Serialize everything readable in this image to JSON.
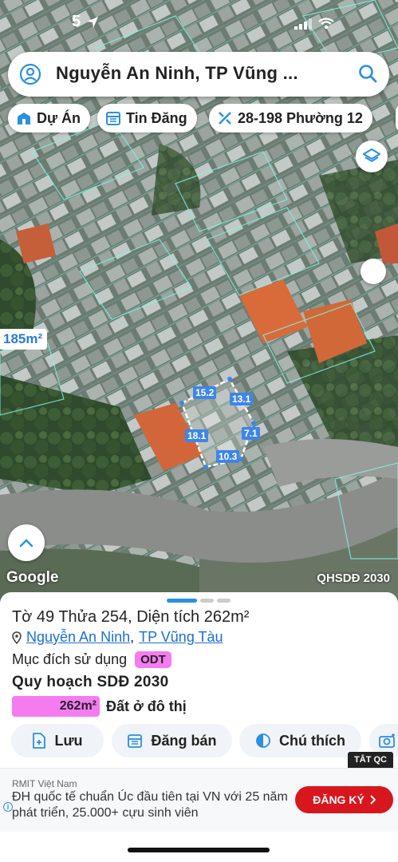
{
  "status_bar": {
    "time": "5"
  },
  "search": {
    "query": "Nguyễn An Ninh, TP Vũng ..."
  },
  "filters": [
    {
      "label": "Dự Án"
    },
    {
      "label": "Tin Đăng"
    },
    {
      "label": "28-198 Phường 12"
    }
  ],
  "map": {
    "area_tag": "185m²",
    "edges": [
      "15.2",
      "13.1",
      "18.1",
      "7.1",
      "10.3"
    ],
    "google": "Google",
    "layer_name": "QHSDĐ 2030"
  },
  "parcel": {
    "title": "Tờ 49 Thửa 254, Diện tích 262m²",
    "street": "Nguyễn An Ninh",
    "separator": ",",
    "city": "TP Vũng Tàu",
    "purpose_label": "Mục đích sử dụng",
    "purpose_code": "ODT",
    "plan_title": "Quy hoạch SDĐ 2030",
    "plan_area": "262m²",
    "plan_type": "Đất ở đô thị"
  },
  "actions": [
    {
      "label": "Lưu"
    },
    {
      "label": "Đăng bán"
    },
    {
      "label": "Chú thích"
    }
  ],
  "ad": {
    "close_label": "TẮT QC",
    "sponsor": "RMIT Việt Nam",
    "text": "ĐH quốc tế chuẩn Úc đầu tiên tại VN với 25 năm phát triển, 25.000+ cựu sinh viên",
    "cta": "ĐĂNG KÝ",
    "info": "i"
  },
  "colors": {
    "accent": "#2a90e0",
    "odt_pink": "#f57cf0",
    "cta_red": "#d8161e",
    "parcel_blue": "#3d86e8"
  }
}
